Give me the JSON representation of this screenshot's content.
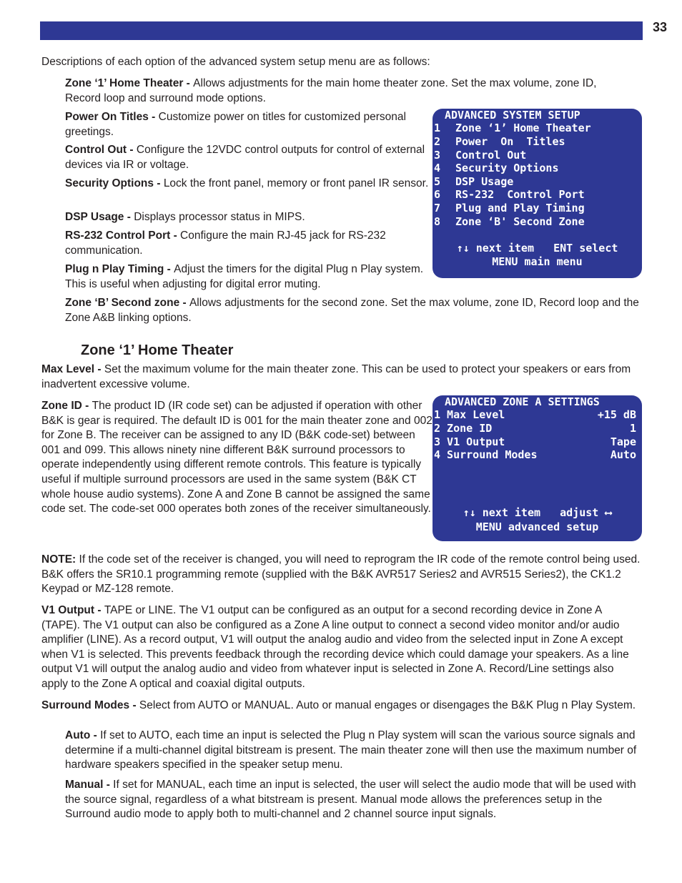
{
  "page": {
    "number": "33",
    "header_color": "#2e3894"
  },
  "intro": "Descriptions of each option of the advanced system setup menu are as follows:",
  "options": [
    {
      "term": "Zone ‘1’ Home Theater - ",
      "desc": "Allows adjustments for the main home theater zone.  Set the max volume, zone ID, Record loop and surround mode options."
    },
    {
      "term": "Power On Titles - ",
      "desc": "Customize power on titles for customized personal greetings."
    },
    {
      "term": "Control Out - ",
      "desc": "Configure the 12VDC control outputs for control of external devices via IR or voltage."
    },
    {
      "term": "Security Options - ",
      "desc": "Lock the front panel, memory or front panel IR sensor."
    },
    {
      "term": "DSP Usage - ",
      "desc": "Displays processor status in MIPS."
    },
    {
      "term": "RS-232 Control Port - ",
      "desc": "Configure the main RJ-45 jack for RS-232 communication."
    },
    {
      "term": "Plug n Play Timing - ",
      "desc": "Adjust the timers for the digital Plug n Play system.  This is useful when adjusting for digital error muting."
    },
    {
      "term": "Zone ‘B’ Second zone - ",
      "desc": "Allows adjustments for the second zone.  Set the max volume, zone ID, Record loop and the Zone A&B linking options."
    }
  ],
  "osd_system": {
    "title": "ADVANCED SYSTEM SETUP",
    "items": [
      {
        "num": "1",
        "label": "Zone ‘1’ Home Theater"
      },
      {
        "num": "2",
        "label": "Power  On  Titles"
      },
      {
        "num": "3",
        "label": "Control Out"
      },
      {
        "num": "4",
        "label": "Security Options"
      },
      {
        "num": "5",
        "label": "DSP Usage"
      },
      {
        "num": "6",
        "label": "RS-232  Control Port"
      },
      {
        "num": "7",
        "label": "Plug and Play Timing"
      },
      {
        "num": "8",
        "label": "Zone ‘B' Second Zone"
      }
    ],
    "footer1": "↑↓ next item   ENT select",
    "footer2": "MENU main menu"
  },
  "section": {
    "title": "Zone ‘1’ Home Theater",
    "max_level": {
      "term": "Max Level - ",
      "desc": "Set the maximum volume for the main theater zone. This can be used to protect your speakers or ears from inadvertent excessive volume."
    },
    "zone_id": {
      "term": "Zone ID - ",
      "desc": "The product ID (IR code set) can be adjusted if operation with other B&K is gear is required.  The default ID is 001 for the main theater zone and 002 for Zone B.  The receiver can be assigned to any ID (B&K code-set) between 001 and 099.  This allows ninety nine different B&K surround processors to operate independently using different remote controls.  This feature is typically useful if multiple surround processors are used in the same system (B&K CT whole house audio systems).  Zone A and Zone B cannot be assigned the same code set. The code-set 000 operates both zones of the receiver simultaneously."
    },
    "note": {
      "term": "NOTE: ",
      "desc": "If the code set of the receiver is changed, you will need to reprogram the IR code of the remote control being used.  B&K offers the SR10.1 programming remote (supplied with the B&K AVR517 Series2 and AVR515 Series2), the CK1.2 Keypad or MZ-128 remote."
    },
    "v1_output": {
      "term": "V1 Output - ",
      "desc": "TAPE or LINE. The V1 output can be configured as an output for a second recording device in Zone A (TAPE). The V1 output can also be configured as a Zone A line output to connect a second video monitor and/or audio amplifier (LINE). As a record output, V1 will output the analog audio and video from the selected input in Zone A except when V1 is selected. This prevents feedback through the recording device which could damage your speakers. As a line output V1 will output the analog audio and video from whatever input is selected in Zone A. Record/Line settings also apply to the Zone A optical and coaxial digital outputs."
    },
    "surround_modes": {
      "term": "Surround Modes - ",
      "desc": "Select from AUTO or MANUAL. Auto or manual engages or disengages the B&K Plug n Play System."
    },
    "auto": {
      "term": "Auto - ",
      "desc": "If set to AUTO, each time an input is selected the Plug n Play system will scan the various source signals and determine if a multi-channel digital bitstream is present.  The main theater zone will then use the maximum number of hardware speakers specified in the speaker setup menu."
    },
    "manual": {
      "term": "Manual - ",
      "desc": "If set for MANUAL, each time an input is selected, the user will select the audio mode that will be used with the source signal, regardless of a what bitstream is present.  Manual mode allows the preferences setup in the Surround audio mode to apply both to multi-channel and 2 channel source input signals."
    }
  },
  "osd_zone": {
    "title": "ADVANCED ZONE A SETTINGS",
    "items": [
      {
        "label": "1 Max Level",
        "value": "+15 dB"
      },
      {
        "label": "2 Zone ID",
        "value": "1"
      },
      {
        "label": "3 V1 Output",
        "value": "Tape"
      },
      {
        "label": "4 Surround Modes",
        "value": "Auto"
      }
    ],
    "footer1": "↑↓ next item   adjust ⟷",
    "footer2": "MENU advanced setup"
  }
}
